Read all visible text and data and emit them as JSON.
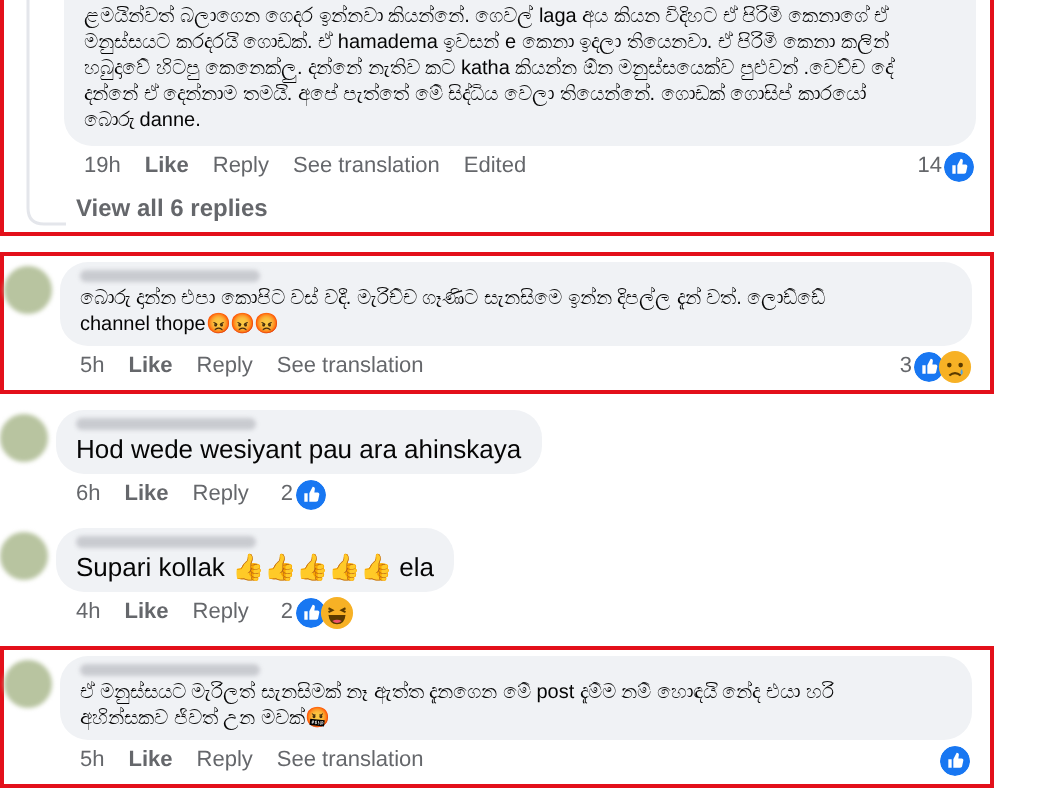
{
  "comments": [
    {
      "cut_off_top": true,
      "highlighted": true,
      "lines": [
        "ළමයින්වත් බලාගෙන ගෙදර ඉන්නවා කියන්නේ. ගෙවල් laga අය කියන විදිහට ඒ පිරිමි කෙනාගේ ඒ",
        "මනුස්සයට කරදරයි ගොඩක්. ඒ hamadema ඉවසන් e කෙනා ඉදලා තියෙනවා. ඒ පිරිමි කෙනා කලින්",
        "හබුදාවේ හිටපු කෙනෙක්ලු. දන්නේ නැතිව කට katha කියන්න ඕන මනුස්සයෙක්ව පුළුවන් .වෙච්ච දේ",
        "දන්නේ ඒ දෙන්නාම තමයි. අපේ පැත්තේ මේ සිද්ධිය වෙලා තියෙන්නේ. ගොඩක් ගොසිප් කාරයෝ",
        "බොරු danne."
      ],
      "time": "19h",
      "actions": [
        {
          "label": "Like",
          "kind": "like"
        },
        {
          "label": "Reply",
          "kind": "reply"
        },
        {
          "label": "See translation",
          "kind": "translate"
        },
        {
          "label": "Edited",
          "kind": "note"
        }
      ],
      "reaction_count": "14",
      "reactions": [
        {
          "kind": "like"
        }
      ],
      "view_replies": "View all 6 replies"
    },
    {
      "cut_off_top": false,
      "highlighted": true,
      "lines": [
        "බොරු දාන්න එපා කොපිට වස් වදී. මැරිච්ච ගෑණිට සැනසිමෙ ඉන්න දිපල්ල දැන් වත්. ලොඩ්ඩේ",
        "channel thope😡😡😡"
      ],
      "time": "5h",
      "actions": [
        {
          "label": "Like",
          "kind": "like"
        },
        {
          "label": "Reply",
          "kind": "reply"
        },
        {
          "label": "See translation",
          "kind": "translate"
        }
      ],
      "reaction_count": "3",
      "reactions": [
        {
          "kind": "like"
        },
        {
          "kind": "sad"
        }
      ]
    },
    {
      "cut_off_top": false,
      "highlighted": false,
      "lines": [
        "Hod wede wesiyant pau ara ahinskaya"
      ],
      "time": "6h",
      "actions": [
        {
          "label": "Like",
          "kind": "like"
        },
        {
          "label": "Reply",
          "kind": "reply"
        }
      ],
      "reaction_count": "2",
      "reactions": [
        {
          "kind": "like"
        }
      ]
    },
    {
      "cut_off_top": false,
      "highlighted": false,
      "lines": [
        "Supari kollak 👍👍👍👍👍 ela"
      ],
      "time": "4h",
      "actions": [
        {
          "label": "Like",
          "kind": "like"
        },
        {
          "label": "Reply",
          "kind": "reply"
        }
      ],
      "reaction_count": "2",
      "reactions": [
        {
          "kind": "like"
        },
        {
          "kind": "haha"
        }
      ]
    },
    {
      "cut_off_top": false,
      "highlighted": true,
      "lines": [
        "ඒ මනුස්සයට මැරිලත් සැනසිමක් නෑ ඇත්ත දැනගෙන මේ post දැම්ම නම් හොඳයි නේද එයා හරි",
        "අහින්සකව ජිවත් උන මවක්🤬"
      ],
      "time": "5h",
      "actions": [
        {
          "label": "Like",
          "kind": "like"
        },
        {
          "label": "Reply",
          "kind": "reply"
        },
        {
          "label": "See translation",
          "kind": "translate"
        }
      ],
      "reactions": [
        {
          "kind": "like"
        }
      ]
    }
  ]
}
